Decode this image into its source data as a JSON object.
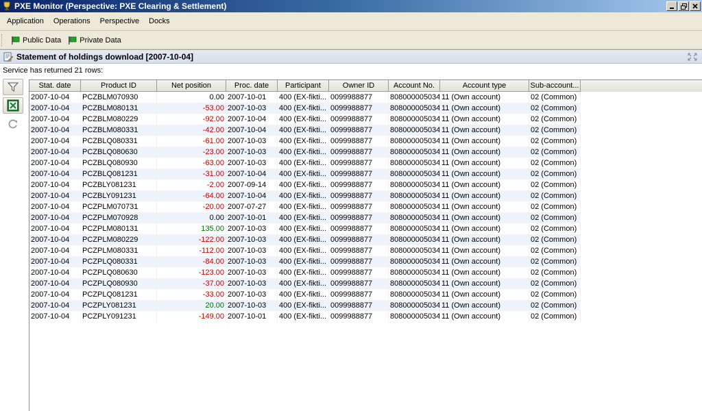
{
  "window": {
    "title": "PXE Monitor (Perspective: PXE Clearing & Settlement)"
  },
  "menu": [
    "Application",
    "Operations",
    "Perspective",
    "Docks"
  ],
  "toolbar": {
    "public_data": "Public Data",
    "private_data": "Private Data"
  },
  "panel": {
    "title": "Statement of holdings download [2007-10-04]",
    "status": "Service has returned 21 rows:"
  },
  "table": {
    "columns": [
      "Stat. date",
      "Product ID",
      "Net position",
      "Proc. date",
      "Participant",
      "Owner ID",
      "Account No.",
      "Account type",
      "Sub-account..."
    ],
    "rows": [
      [
        "2007-10-04",
        "PCZBLM070930",
        "0.00",
        "2007-10-01",
        "400 (EX-fikti...",
        "0099988877",
        "808000005034",
        "11 (Own account)",
        "02 (Common)"
      ],
      [
        "2007-10-04",
        "PCZBLM080131",
        "-53.00",
        "2007-10-03",
        "400 (EX-fikti...",
        "0099988877",
        "808000005034",
        "11 (Own account)",
        "02 (Common)"
      ],
      [
        "2007-10-04",
        "PCZBLM080229",
        "-92.00",
        "2007-10-04",
        "400 (EX-fikti...",
        "0099988877",
        "808000005034",
        "11 (Own account)",
        "02 (Common)"
      ],
      [
        "2007-10-04",
        "PCZBLM080331",
        "-42.00",
        "2007-10-04",
        "400 (EX-fikti...",
        "0099988877",
        "808000005034",
        "11 (Own account)",
        "02 (Common)"
      ],
      [
        "2007-10-04",
        "PCZBLQ080331",
        "-61.00",
        "2007-10-03",
        "400 (EX-fikti...",
        "0099988877",
        "808000005034",
        "11 (Own account)",
        "02 (Common)"
      ],
      [
        "2007-10-04",
        "PCZBLQ080630",
        "-23.00",
        "2007-10-03",
        "400 (EX-fikti...",
        "0099988877",
        "808000005034",
        "11 (Own account)",
        "02 (Common)"
      ],
      [
        "2007-10-04",
        "PCZBLQ080930",
        "-63.00",
        "2007-10-03",
        "400 (EX-fikti...",
        "0099988877",
        "808000005034",
        "11 (Own account)",
        "02 (Common)"
      ],
      [
        "2007-10-04",
        "PCZBLQ081231",
        "-31.00",
        "2007-10-04",
        "400 (EX-fikti...",
        "0099988877",
        "808000005034",
        "11 (Own account)",
        "02 (Common)"
      ],
      [
        "2007-10-04",
        "PCZBLY081231",
        "-2.00",
        "2007-09-14",
        "400 (EX-fikti...",
        "0099988877",
        "808000005034",
        "11 (Own account)",
        "02 (Common)"
      ],
      [
        "2007-10-04",
        "PCZBLY091231",
        "-64.00",
        "2007-10-04",
        "400 (EX-fikti...",
        "0099988877",
        "808000005034",
        "11 (Own account)",
        "02 (Common)"
      ],
      [
        "2007-10-04",
        "PCZPLM070731",
        "-20.00",
        "2007-07-27",
        "400 (EX-fikti...",
        "0099988877",
        "808000005034",
        "11 (Own account)",
        "02 (Common)"
      ],
      [
        "2007-10-04",
        "PCZPLM070928",
        "0.00",
        "2007-10-01",
        "400 (EX-fikti...",
        "0099988877",
        "808000005034",
        "11 (Own account)",
        "02 (Common)"
      ],
      [
        "2007-10-04",
        "PCZPLM080131",
        "135.00",
        "2007-10-03",
        "400 (EX-fikti...",
        "0099988877",
        "808000005034",
        "11 (Own account)",
        "02 (Common)"
      ],
      [
        "2007-10-04",
        "PCZPLM080229",
        "-122.00",
        "2007-10-03",
        "400 (EX-fikti...",
        "0099988877",
        "808000005034",
        "11 (Own account)",
        "02 (Common)"
      ],
      [
        "2007-10-04",
        "PCZPLM080331",
        "-112.00",
        "2007-10-03",
        "400 (EX-fikti...",
        "0099988877",
        "808000005034",
        "11 (Own account)",
        "02 (Common)"
      ],
      [
        "2007-10-04",
        "PCZPLQ080331",
        "-84.00",
        "2007-10-03",
        "400 (EX-fikti...",
        "0099988877",
        "808000005034",
        "11 (Own account)",
        "02 (Common)"
      ],
      [
        "2007-10-04",
        "PCZPLQ080630",
        "-123.00",
        "2007-10-03",
        "400 (EX-fikti...",
        "0099988877",
        "808000005034",
        "11 (Own account)",
        "02 (Common)"
      ],
      [
        "2007-10-04",
        "PCZPLQ080930",
        "-37.00",
        "2007-10-03",
        "400 (EX-fikti...",
        "0099988877",
        "808000005034",
        "11 (Own account)",
        "02 (Common)"
      ],
      [
        "2007-10-04",
        "PCZPLQ081231",
        "-33.00",
        "2007-10-03",
        "400 (EX-fikti...",
        "0099988877",
        "808000005034",
        "11 (Own account)",
        "02 (Common)"
      ],
      [
        "2007-10-04",
        "PCZPLY081231",
        "20.00",
        "2007-10-03",
        "400 (EX-fikti...",
        "0099988877",
        "808000005034",
        "11 (Own account)",
        "02 (Common)"
      ],
      [
        "2007-10-04",
        "PCZPLY091231",
        "-149.00",
        "2007-10-01",
        "400 (EX-fikti...",
        "0099988877",
        "808000005034",
        "11 (Own account)",
        "02 (Common)"
      ]
    ]
  },
  "icons": {
    "app": "trophy-icon",
    "public_data": "green-flag-icon",
    "private_data": "green-flag-icon",
    "panel": "document-edit-icon",
    "filter": "funnel-icon",
    "excel": "excel-export-icon",
    "refresh": "refresh-icon",
    "maximize": "maximize-panel-icon"
  },
  "colors": {
    "negative": "#c00000",
    "positive": "#007000",
    "title_bar": "#0a246a"
  }
}
